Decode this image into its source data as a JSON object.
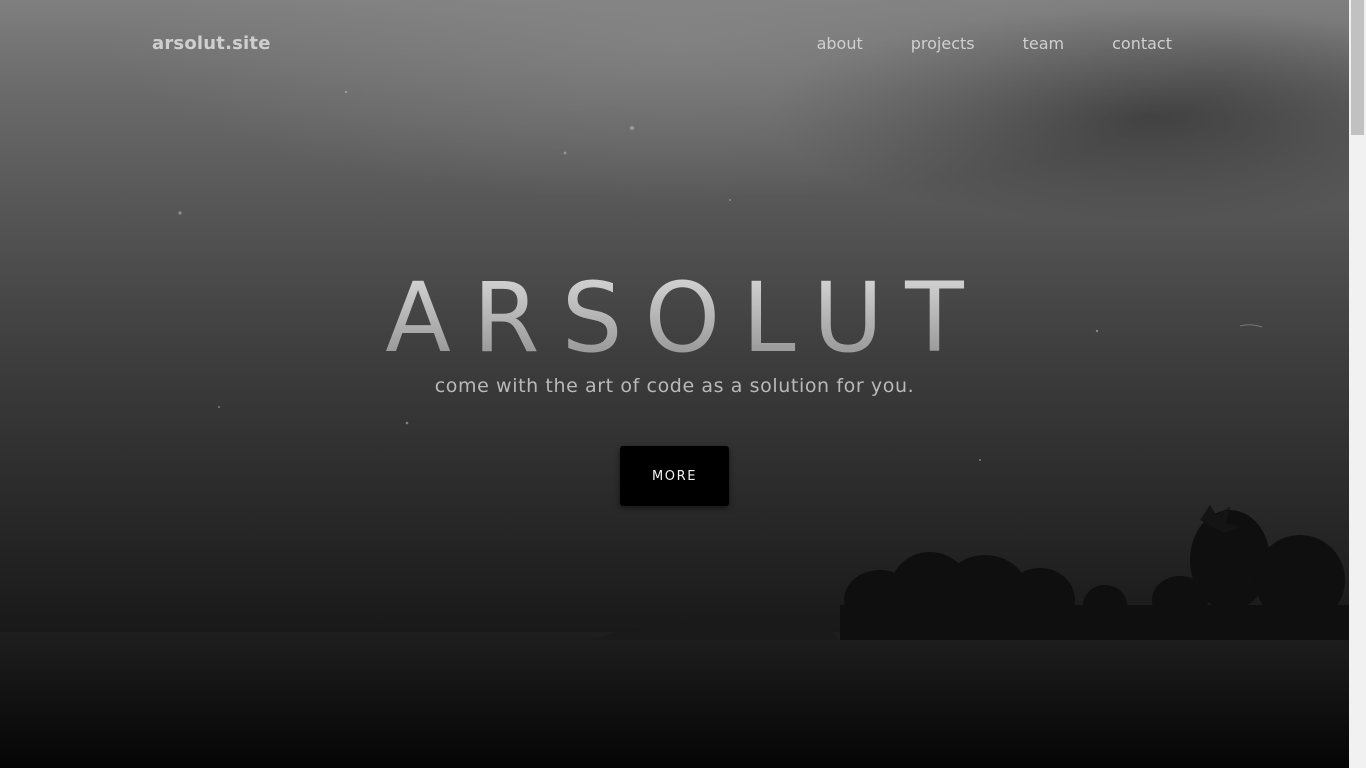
{
  "nav": {
    "brand": "arsolut.site",
    "links": [
      "about",
      "projects",
      "team",
      "contact"
    ]
  },
  "hero": {
    "title": "ARSOLUT",
    "subtitle": "come with the art of code as a solution for you.",
    "button_label": "MORE"
  },
  "colors": {
    "button_bg": "#000000",
    "nav_text": "#d0d0d0",
    "scrollbar_track": "#f1f1f1",
    "scrollbar_thumb": "#c1c1c1"
  }
}
